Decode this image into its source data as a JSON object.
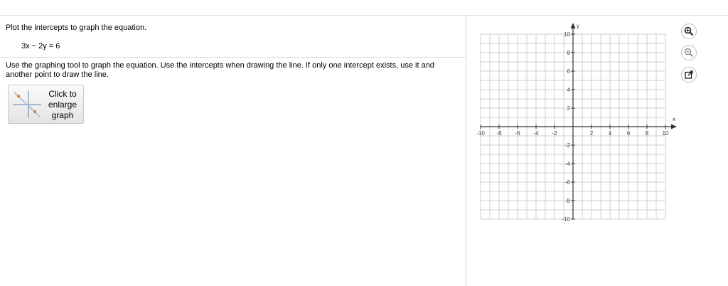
{
  "question": {
    "title": "Plot the intercepts to graph the equation.",
    "equation": "3x − 2y = 6",
    "instructions": "Use the graphing tool to graph the equation.  Use the intercepts when drawing the line.  If only one intercept exists, use it and another point to draw the line."
  },
  "enlarge_button": {
    "line1": "Click to",
    "line2": "enlarge",
    "line3": "graph"
  },
  "graph": {
    "x_axis_label": "x",
    "y_axis_label": "y",
    "x_range": [
      -10,
      10
    ],
    "y_range": [
      -10,
      10
    ],
    "grid_step": 1,
    "tick_label_step": 2,
    "x_tick_labels": [
      "-10",
      "-8",
      "-6",
      "-4",
      "-2",
      "2",
      "4",
      "6",
      "8",
      "10"
    ],
    "y_tick_labels": [
      "10",
      "8",
      "6",
      "4",
      "2",
      "-2",
      "-4",
      "-6",
      "-8",
      "-10"
    ]
  },
  "tools": [
    {
      "name": "zoom-in-icon",
      "color": "#1a1a1a"
    },
    {
      "name": "zoom-out-icon",
      "color": "#7a7a7a"
    },
    {
      "name": "open-external-icon",
      "color": "#1a1a1a"
    }
  ],
  "colors": {
    "grid": "#cfcfcf",
    "axis": "#333333",
    "divider": "#d9d9d9"
  }
}
